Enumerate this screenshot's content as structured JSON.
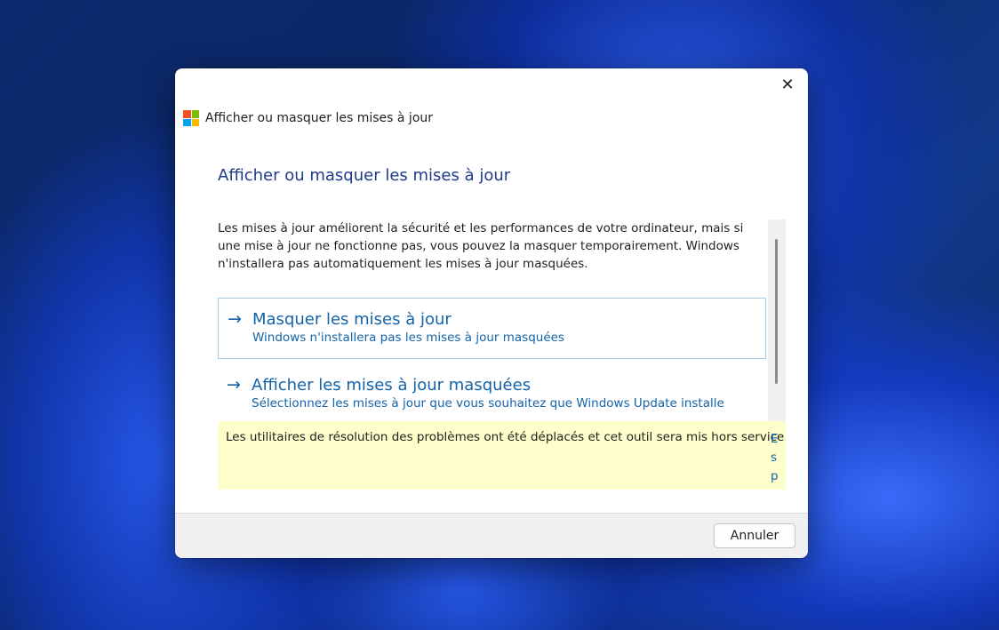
{
  "dialog": {
    "title": "Afficher ou masquer les mises à jour",
    "close_icon": "✕",
    "heading": "Afficher ou masquer les mises à jour",
    "description": "Les mises à jour améliorent la sécurité et les performances de votre ordinateur, mais si une mise à jour ne fonctionne pas, vous pouvez la masquer temporairement. Windows n'installera pas automatiquement les mises à jour masquées.",
    "options": [
      {
        "icon": "arrow-right-icon",
        "arrow": "→",
        "title": "Masquer les mises à jour",
        "subtitle": "Windows n'installera pas les mises à jour masquées"
      },
      {
        "icon": "arrow-right-icon",
        "arrow": "→",
        "title": "Afficher les mises à jour masquées",
        "subtitle": "Sélectionnez les mises à jour que vous souhaitez que Windows Update installe"
      }
    ],
    "notice": {
      "text": "Les utilitaires de résolution des problèmes ont été déplacés et cet outil sera mis hors service.",
      "link_fragment": "E s p"
    },
    "cancel_label": "Annuler"
  }
}
